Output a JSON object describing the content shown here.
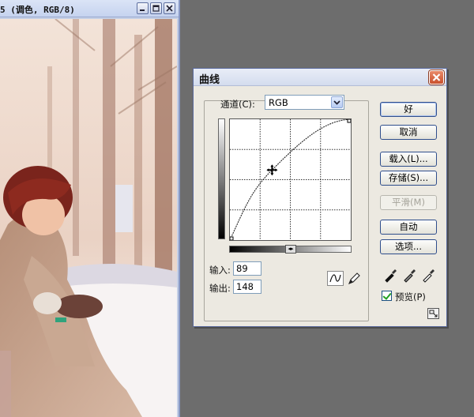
{
  "document": {
    "title": "5 (调色, RGB/8)"
  },
  "dialog": {
    "title": "曲线",
    "channel": {
      "label": "通道(C):",
      "value": "RGB"
    },
    "input": {
      "label": "输入:",
      "value": "89"
    },
    "output": {
      "label": "输出:",
      "value": "148"
    },
    "buttons": {
      "ok": "好",
      "cancel": "取消",
      "load": "载入(L)...",
      "save": "存储(S)...",
      "smooth": "平滑(M)",
      "auto": "自动",
      "options": "选项..."
    },
    "preview": {
      "label": "预览(P)",
      "checked": true
    },
    "curve": {
      "points_input_output": [
        [
          0,
          0
        ],
        [
          89,
          148
        ],
        [
          255,
          255
        ]
      ]
    },
    "colors": {
      "dialog_bg": "#ece9e1",
      "button_border": "#2f4e8c",
      "close_red": "#c9502c"
    }
  },
  "icons": [
    "minimize-icon",
    "maximize-icon",
    "close-icon",
    "curve-tool-icon",
    "pencil-tool-icon",
    "black-eyedropper-icon",
    "gray-eyedropper-icon",
    "white-eyedropper-icon",
    "expand-icon"
  ]
}
